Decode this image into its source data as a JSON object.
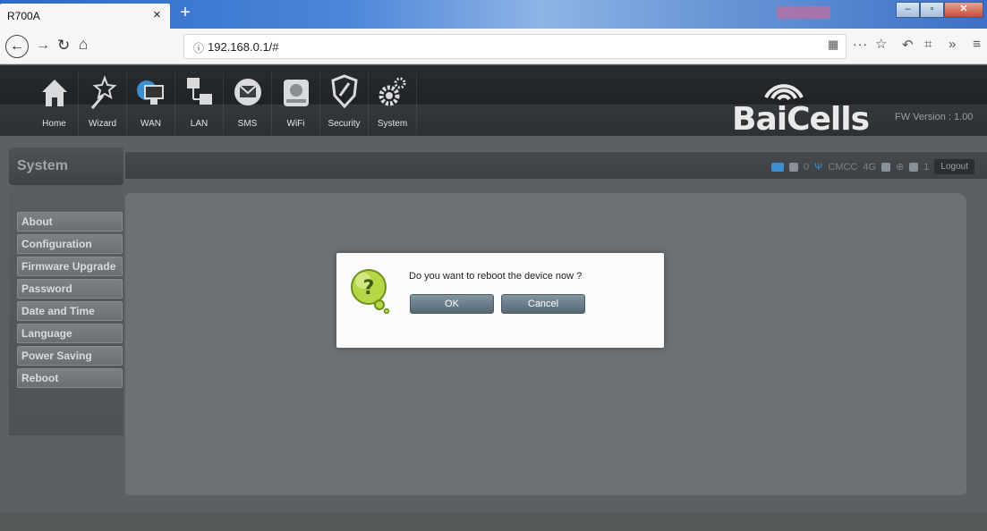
{
  "browser": {
    "tab_title": "R700A",
    "tab_close": "×",
    "new_tab": "+",
    "url": "192.168.0.1/#"
  },
  "header": {
    "menu": [
      {
        "label": "Home",
        "icon": "house-icon"
      },
      {
        "label": "Wizard",
        "icon": "wand-icon"
      },
      {
        "label": "WAN",
        "icon": "globe-monitor-icon"
      },
      {
        "label": "LAN",
        "icon": "network-icon"
      },
      {
        "label": "SMS",
        "icon": "envelope-icon"
      },
      {
        "label": "WiFi",
        "icon": "router-icon"
      },
      {
        "label": "Security",
        "icon": "shield-icon"
      },
      {
        "label": "System",
        "icon": "gears-icon"
      }
    ],
    "brand_part1": "Bai",
    "brand_part2": "Cells",
    "fw_version": "FW Version : 1.00"
  },
  "status": {
    "count_a": "0",
    "operator": "CMCC",
    "network": "4G",
    "count_b": "1",
    "logout_label": "Logout"
  },
  "sidebar": {
    "title": "System",
    "items": [
      {
        "label": "About"
      },
      {
        "label": "Configuration"
      },
      {
        "label": "Firmware Upgrade"
      },
      {
        "label": "Password"
      },
      {
        "label": "Date and Time"
      },
      {
        "label": "Language"
      },
      {
        "label": "Power Saving"
      },
      {
        "label": "Reboot"
      }
    ]
  },
  "dialog": {
    "message": "Do you want to reboot the device now ?",
    "ok_label": "OK",
    "cancel_label": "Cancel"
  },
  "colors": {
    "brand_blue": "#3a8fd3",
    "dialog_button": "#6b7c89"
  }
}
